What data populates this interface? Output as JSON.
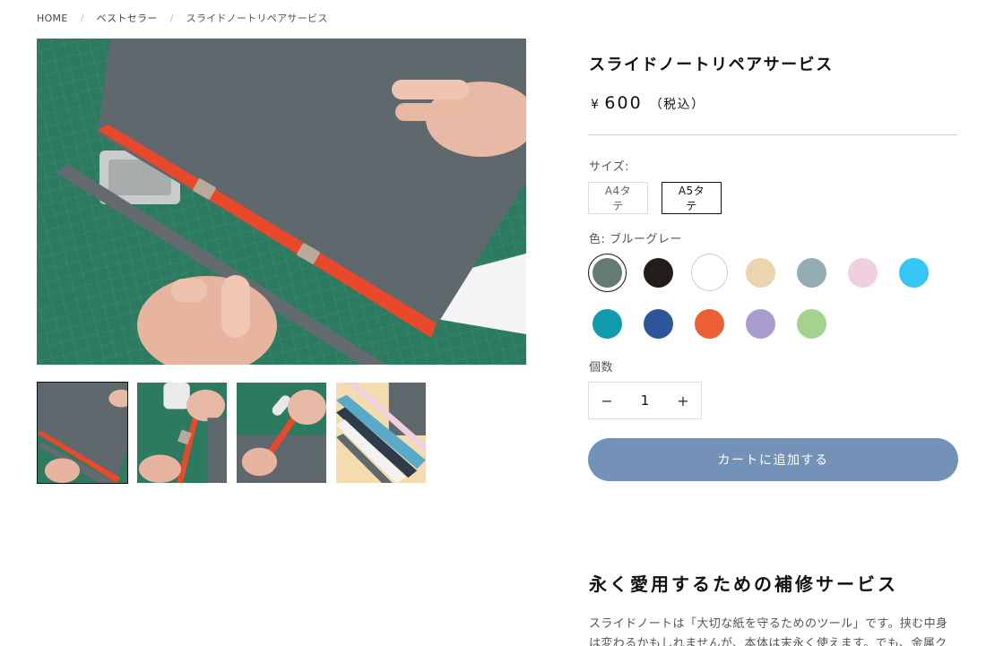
{
  "breadcrumb": {
    "items": [
      "HOME",
      "ベストセラー",
      "スライドノートリペアサービス"
    ],
    "separator": "/"
  },
  "product": {
    "title": "スライドノートリペアサービス",
    "currency": "¥",
    "price": "600",
    "tax_note": "（税込）"
  },
  "size": {
    "label": "サイズ:",
    "options": [
      "A4タテ",
      "A5タテ"
    ],
    "selected": "A5タテ"
  },
  "color": {
    "label": "色: ブルーグレー",
    "swatches": [
      {
        "name": "ブルーグレー",
        "hex": "#637b70",
        "selected": true
      },
      {
        "name": "ブラック",
        "hex": "#221c1a"
      },
      {
        "name": "ホワイト",
        "hex": "#ffffff"
      },
      {
        "name": "ベージュ",
        "hex": "#ecd4ae"
      },
      {
        "name": "グレー",
        "hex": "#93adb3"
      },
      {
        "name": "ピンク",
        "hex": "#f0d0df"
      },
      {
        "name": "スカイブルー",
        "hex": "#35c6f4"
      },
      {
        "name": "ターコイズ",
        "hex": "#0f9aae"
      },
      {
        "name": "ネイビー",
        "hex": "#2d559b"
      },
      {
        "name": "オレンジ",
        "hex": "#eb5e36"
      },
      {
        "name": "パープル",
        "hex": "#aa9ccf"
      },
      {
        "name": "グリーン",
        "hex": "#a4d38d"
      }
    ]
  },
  "quantity": {
    "label": "個数",
    "value": "1",
    "minus": "−",
    "plus": "+"
  },
  "cart": {
    "button_label": "カートに追加する",
    "button_color": "#7492b8"
  },
  "description": {
    "heading": "永く愛用するための補修サービス",
    "text": "スライドノートは「大切な紙を守るためのツール」です。挟む中身は変わるかもしれませんが、本体は末永く使えます。でも、金属ク"
  },
  "gallery": {
    "thumbnail_count": 4,
    "active_index": 0
  }
}
